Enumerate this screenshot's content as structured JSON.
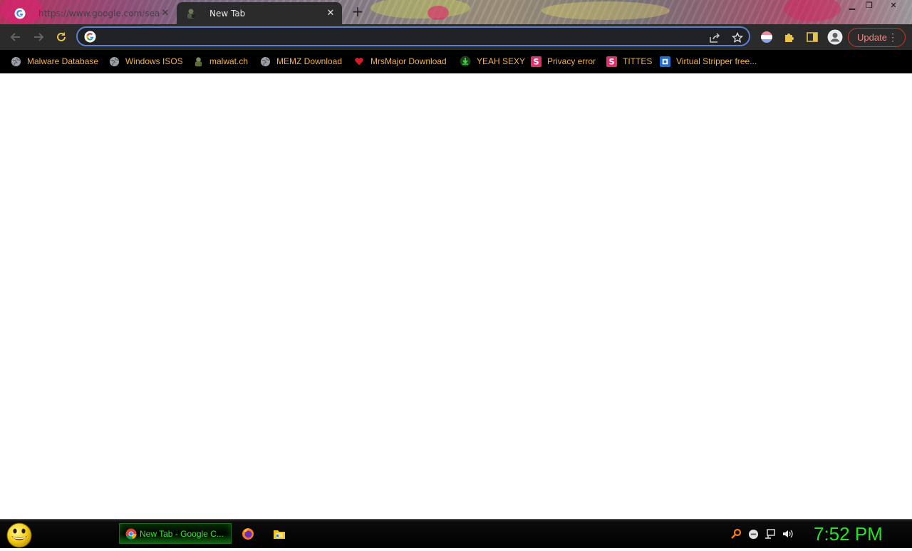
{
  "tabs": [
    {
      "title": "https://www.google.com/search",
      "active": false
    },
    {
      "title": "New Tab",
      "active": true
    }
  ],
  "omnibox": {
    "value": "",
    "placeholder": ""
  },
  "toolbar": {
    "update_label": "Update"
  },
  "bookmarks": [
    {
      "label": "Malware Database",
      "icon": "globe-icon"
    },
    {
      "label": "Windows ISOS",
      "icon": "globe-icon"
    },
    {
      "label": "malwat.ch",
      "icon": "hacker-icon"
    },
    {
      "label": "MEMZ Download",
      "icon": "globe-icon"
    },
    {
      "label": "MrsMajor Download",
      "icon": "heart-icon"
    },
    {
      "label": "YEAH SEXY",
      "icon": "download-icon"
    },
    {
      "label": "Privacy error",
      "icon": "s-icon"
    },
    {
      "label": "TITTES",
      "icon": "s-icon"
    },
    {
      "label": "Virtual Stripper free...",
      "icon": "blue-square-icon"
    }
  ],
  "taskbar": {
    "chrome_task_label": "New Tab - Google C...",
    "clock": "7:52 PM"
  },
  "colors": {
    "bookmark_text": "#f1b24a",
    "clock": "#28e028",
    "update_border": "#d93025",
    "omnibox_border": "#5b7fd6"
  }
}
